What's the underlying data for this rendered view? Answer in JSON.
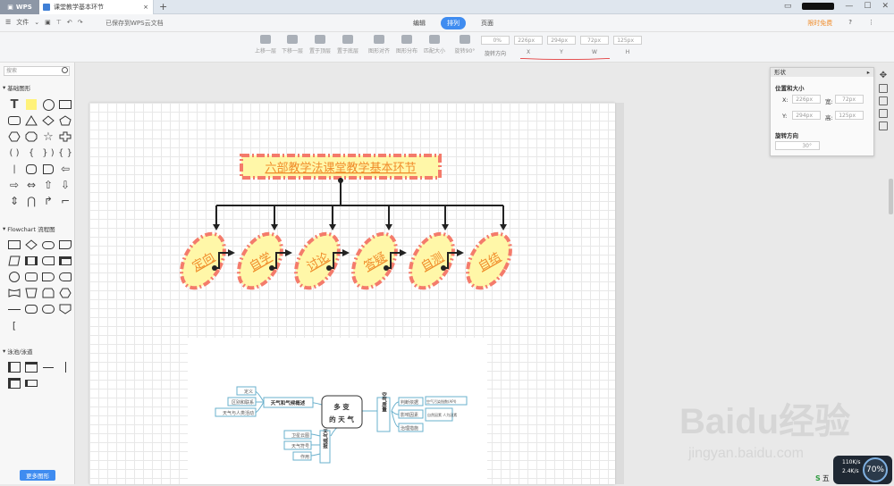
{
  "titlebar": {
    "app_label": "WPS",
    "doc_tab": "课堂教学基本环节",
    "add_tab": "+"
  },
  "menubar": {
    "file": "文件",
    "saved_status": "已保存到WPS云文档",
    "mode_tabs": [
      "编辑",
      "排列",
      "页面"
    ],
    "active_mode": "排列",
    "limited_free": "限时免费",
    "help": "?"
  },
  "toolbar": {
    "buttons": [
      "上移一层",
      "下移一层",
      "置于顶层",
      "置于底层",
      "图形对齐",
      "图形分布",
      "匹配大小",
      "旋转90°"
    ],
    "rotate_value": "0%",
    "x_value": "226px",
    "y_value": "294px",
    "w_value": "72px",
    "h_value": "125px",
    "labels": {
      "rotate": "旋转方向",
      "x": "X",
      "y": "Y",
      "w": "W",
      "h": "H"
    },
    "accent_color": "#e02020"
  },
  "sidebar": {
    "search_placeholder": "搜索",
    "sections": [
      "基础图形",
      "Flowchart 流程图",
      "泳池/泳道"
    ],
    "more_button": "更多图形"
  },
  "diagram": {
    "title": "六部教学法课堂教学基本环节",
    "nodes": [
      "定向",
      "自学",
      "讨论",
      "答疑",
      "自测",
      "自结"
    ],
    "fill_color": "#fff7a8",
    "border_color": "#f47b6b",
    "text_color": "#f08c2a"
  },
  "mindmap": {
    "center": "多变的天气",
    "left_branch": "天气和气候概述",
    "left_items": [
      "定义",
      "区别和联系",
      "天气与人类活动"
    ],
    "bottom_branch": "天气预报",
    "bottom_items": [
      "卫星云图",
      "天气符号",
      "作用"
    ],
    "right_branch": "空气质量",
    "right_items": [
      "判断依据",
      "影响因素",
      "治理措施"
    ],
    "right_notes": [
      "空气污染指数(API)",
      "自然因素\n人为因素"
    ]
  },
  "panel": {
    "title": "形状",
    "section_pos": "位置和大小",
    "x_label": "X:",
    "x_value": "226px",
    "w_label": "宽:",
    "w_value": "72px",
    "y_label": "Y:",
    "y_value": "294px",
    "h_label": "高:",
    "h_value": "125px",
    "section_rot": "旋转方向",
    "rot_value": "30°"
  },
  "watermark": {
    "text": "Baidu经验",
    "url": "jingyan.baidu.com"
  },
  "status": {
    "speed_up": "110K/s",
    "speed_down": "2.4K/s",
    "cpu": "70%",
    "ime": "五"
  }
}
